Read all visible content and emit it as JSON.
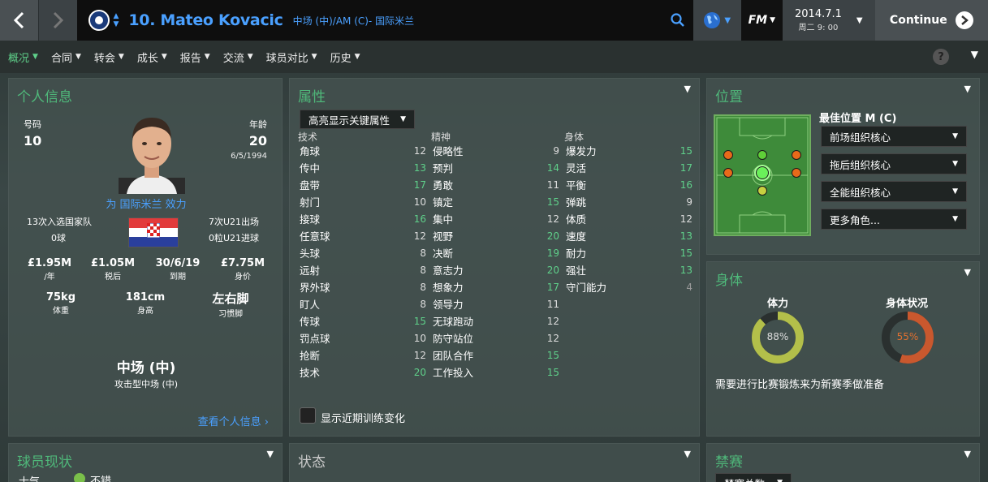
{
  "topbar": {
    "player_title": "10. Mateo Kovacic",
    "player_position": "中场 (中)/AM (C)- 国际米兰",
    "fm_label": "FM",
    "date": "2014.7.1",
    "day_time": "周二 9: 00",
    "continue_label": "Continue"
  },
  "tabs": [
    {
      "label": "概况"
    },
    {
      "label": "合同"
    },
    {
      "label": "转会"
    },
    {
      "label": "成长"
    },
    {
      "label": "报告"
    },
    {
      "label": "交流"
    },
    {
      "label": "球员对比"
    },
    {
      "label": "历史"
    }
  ],
  "help_label": "?",
  "personal": {
    "title": "个人信息",
    "number_label": "号码",
    "number": "10",
    "age_label": "年龄",
    "age": "20",
    "dob": "6/5/1994",
    "club_line": "为 国际米兰 效力",
    "caps": "13次入选国家队",
    "goals": "0球",
    "u21_caps": "7次U21出场",
    "u21_goals": "0粒U21进球",
    "wage": "£1.95M",
    "wage_label": "/年",
    "after_tax": "£1.05M",
    "after_tax_label": "税后",
    "expires": "30/6/19",
    "expires_label": "到期",
    "value": "£7.75M",
    "value_label": "身价",
    "weight": "75kg",
    "weight_label": "体重",
    "height": "181cm",
    "height_label": "身高",
    "foot": "左右脚",
    "foot_label": "习惯脚",
    "position_main": "中场 (中)",
    "position_sub": "攻击型中场 (中)",
    "view_link": "查看个人信息 ›"
  },
  "attributes": {
    "title": "属性",
    "highlight_label": "高亮显示关键属性",
    "technical_label": "技术",
    "mental_label": "精神",
    "physical_label": "身体",
    "show_training_label": "显示近期训练变化",
    "technical": [
      {
        "name": "角球",
        "value": "12"
      },
      {
        "name": "传中",
        "value": "13"
      },
      {
        "name": "盘带",
        "value": "17"
      },
      {
        "name": "射门",
        "value": "10"
      },
      {
        "name": "接球",
        "value": "16"
      },
      {
        "name": "任意球",
        "value": "12"
      },
      {
        "name": "头球",
        "value": "8"
      },
      {
        "name": "远射",
        "value": "8"
      },
      {
        "name": "界外球",
        "value": "8"
      },
      {
        "name": "盯人",
        "value": "8"
      },
      {
        "name": "传球",
        "value": "15"
      },
      {
        "name": "罚点球",
        "value": "10"
      },
      {
        "name": "抢断",
        "value": "12"
      },
      {
        "name": "技术",
        "value": "20"
      }
    ],
    "mental": [
      {
        "name": "侵略性",
        "value": "9"
      },
      {
        "name": "预判",
        "value": "14"
      },
      {
        "name": "勇敢",
        "value": "11"
      },
      {
        "name": "镇定",
        "value": "15"
      },
      {
        "name": "集中",
        "value": "12"
      },
      {
        "name": "视野",
        "value": "20"
      },
      {
        "name": "决断",
        "value": "19"
      },
      {
        "name": "意志力",
        "value": "20"
      },
      {
        "name": "想象力",
        "value": "17"
      },
      {
        "name": "领导力",
        "value": "11"
      },
      {
        "name": "无球跑动",
        "value": "12"
      },
      {
        "name": "防守站位",
        "value": "12"
      },
      {
        "name": "团队合作",
        "value": "15"
      },
      {
        "name": "工作投入",
        "value": "15"
      }
    ],
    "physical": [
      {
        "name": "爆发力",
        "value": "15"
      },
      {
        "name": "灵活",
        "value": "17"
      },
      {
        "name": "平衡",
        "value": "16"
      },
      {
        "name": "弹跳",
        "value": "9"
      },
      {
        "name": "体质",
        "value": "12"
      },
      {
        "name": "速度",
        "value": "13"
      },
      {
        "name": "耐力",
        "value": "15"
      },
      {
        "name": "强壮",
        "value": "13"
      },
      {
        "name": "守门能力",
        "value": "4"
      }
    ]
  },
  "positions": {
    "title": "位置",
    "best_label": "最佳位置 M (C)",
    "roles": [
      "前场组织核心",
      "拖后组织核心",
      "全能组织核心",
      "更多角色..."
    ]
  },
  "fitness": {
    "title": "身体",
    "stamina_label": "体力",
    "stamina_value": "88%",
    "stamina_fraction": 0.88,
    "condition_label": "身体状况",
    "condition_value": "55%",
    "condition_fraction": 0.55,
    "note": "需要进行比赛锻炼来为新赛季做准备"
  },
  "status": {
    "title": "球员现状",
    "morale_label": "士气",
    "morale_value": "不错"
  },
  "form": {
    "title": "状态"
  },
  "bans": {
    "title": "禁赛",
    "dropdown_label": "禁赛总数"
  },
  "colors": {
    "accent": "#4aa0ff",
    "green": "#5fd08a",
    "stamina": "#b3bf4a",
    "condition": "#c9582e"
  }
}
